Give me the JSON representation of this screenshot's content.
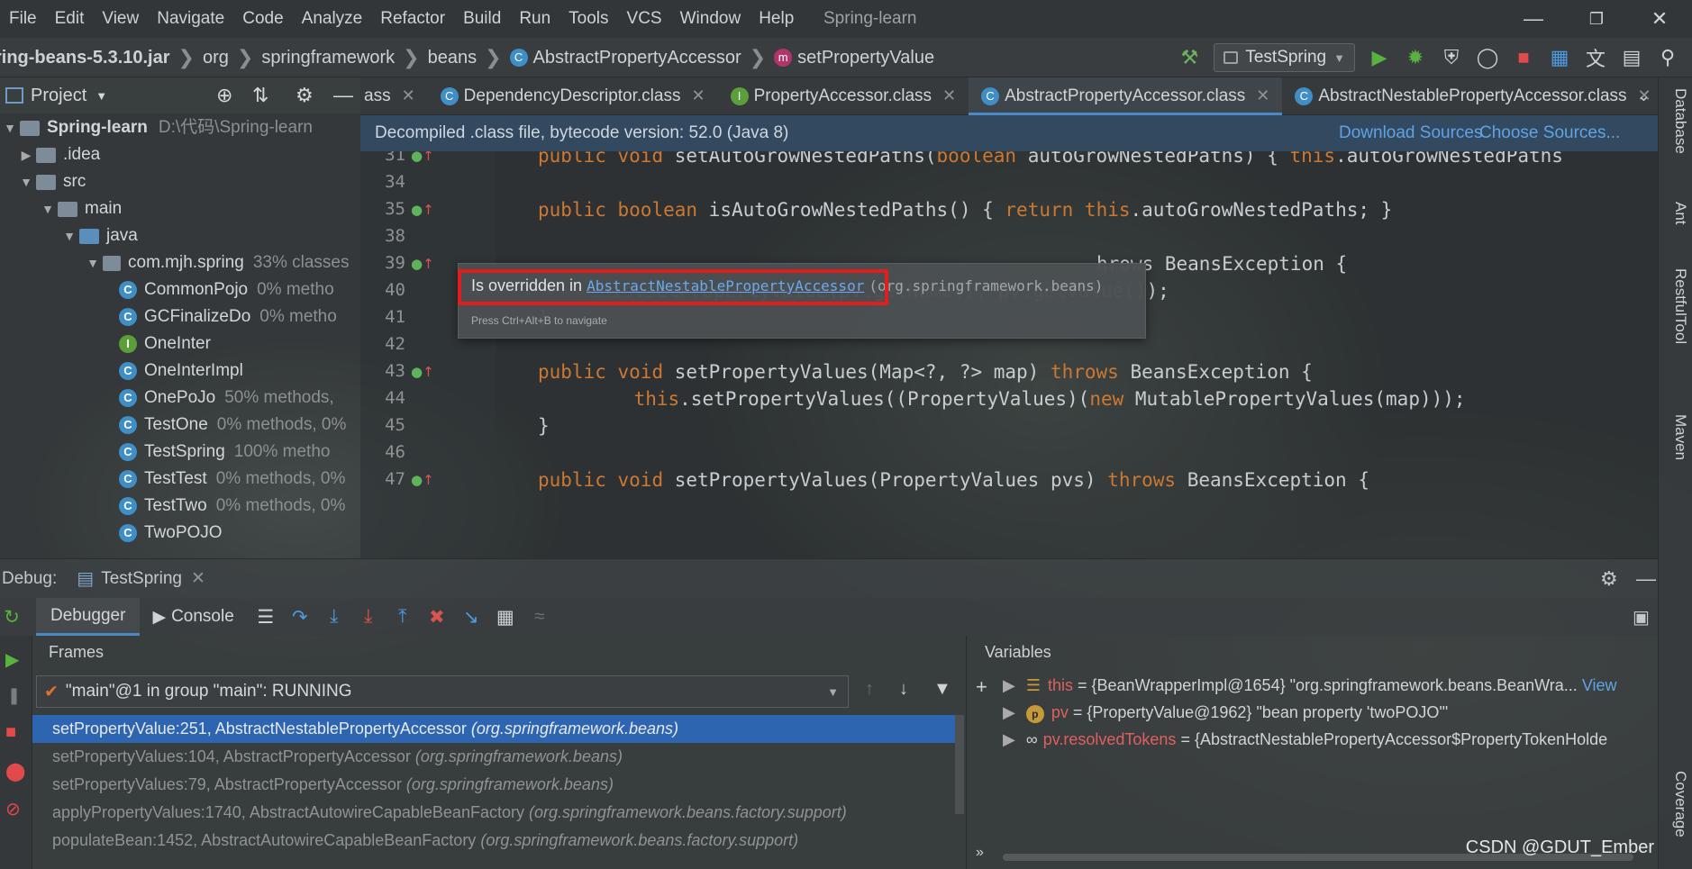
{
  "menu": [
    "File",
    "Edit",
    "View",
    "Navigate",
    "Code",
    "Analyze",
    "Refactor",
    "Build",
    "Run",
    "Tools",
    "VCS",
    "Window",
    "Help"
  ],
  "app_title": "Spring-learn",
  "breadcrumb": [
    "ring-beans-5.3.10.jar",
    "org",
    "springframework",
    "beans",
    "AbstractPropertyAccessor",
    "setPropertyValue"
  ],
  "run_config": "TestSpring",
  "project": {
    "title": "Project",
    "items": [
      {
        "label": "Spring-learn",
        "extra": "D:\\代码\\Spring-learn",
        "kind": "module"
      },
      {
        "label": ".idea",
        "extra": "",
        "kind": "folder"
      },
      {
        "label": "src",
        "extra": "",
        "kind": "folder"
      },
      {
        "label": "main",
        "extra": "",
        "kind": "folder"
      },
      {
        "label": "java",
        "extra": "",
        "kind": "srcfolder"
      },
      {
        "label": "com.mjh.spring",
        "extra": "33% classes",
        "kind": "package"
      },
      {
        "label": "CommonPojo",
        "extra": "0% metho",
        "kind": "class"
      },
      {
        "label": "GCFinalizeDo",
        "extra": "0% metho",
        "kind": "class"
      },
      {
        "label": "OneInter",
        "extra": "",
        "kind": "interface"
      },
      {
        "label": "OneInterImpl",
        "extra": "",
        "kind": "class"
      },
      {
        "label": "OnePoJo",
        "extra": "50% methods,",
        "kind": "class"
      },
      {
        "label": "TestOne",
        "extra": "0% methods, 0%",
        "kind": "class"
      },
      {
        "label": "TestSpring",
        "extra": "100% metho",
        "kind": "class"
      },
      {
        "label": "TestTest",
        "extra": "0% methods, 0%",
        "kind": "class"
      },
      {
        "label": "TestTwo",
        "extra": "0% methods, 0%",
        "kind": "class"
      },
      {
        "label": "TwoPOJO",
        "extra": "",
        "kind": "class"
      }
    ]
  },
  "tabs": [
    {
      "label": "ass",
      "icon": "",
      "active": false
    },
    {
      "label": "DependencyDescriptor.class",
      "icon": "C",
      "active": false
    },
    {
      "label": "PropertyAccessor.class",
      "icon": "I",
      "active": false
    },
    {
      "label": "AbstractPropertyAccessor.class",
      "icon": "C",
      "active": true
    },
    {
      "label": "AbstractNestablePropertyAccessor.class",
      "icon": "C",
      "active": false
    }
  ],
  "infobar": {
    "text": "Decompiled .class file, bytecode version: 52.0 (Java 8)",
    "download": "Download Sources",
    "choose": "Choose Sources..."
  },
  "code_lines": [
    {
      "n": "31",
      "text": "public void setAutoGrowNestedPaths(boolean autoGrowNestedPaths) { this.autoGrowNestedPaths"
    },
    {
      "n": "34",
      "text": ""
    },
    {
      "n": "35",
      "text": "public boolean isAutoGrowNestedPaths() { return this.autoGrowNestedPaths; }"
    },
    {
      "n": "38",
      "text": ""
    },
    {
      "n": "39",
      "text": "hrows BeansException {"
    },
    {
      "n": "40",
      "text": "this.setPropertyValue(pv.getName(), pv.getValue());"
    },
    {
      "n": "41",
      "text": "}"
    },
    {
      "n": "42",
      "text": ""
    },
    {
      "n": "43",
      "text": "public void setPropertyValues(Map<?, ?> map) throws BeansException {"
    },
    {
      "n": "44",
      "text": "    this.setPropertyValues((PropertyValues)(new MutablePropertyValues(map)));"
    },
    {
      "n": "45",
      "text": "}"
    },
    {
      "n": "46",
      "text": ""
    },
    {
      "n": "47",
      "text": "public void setPropertyValues(PropertyValues pvs) throws BeansException {"
    }
  ],
  "tooltip": {
    "prefix": "Is overridden in ",
    "link": "AbstractNestablePropertyAccessor",
    "pkg": "(org.springframework.beans)",
    "hint": "Press Ctrl+Alt+B to navigate"
  },
  "right_tools": [
    "Database",
    "Ant",
    "RestfulTool",
    "Maven",
    "Coverage"
  ],
  "debug": {
    "label": "Debug:",
    "session": "TestSpring",
    "tab_debugger": "Debugger",
    "tab_console": "Console",
    "frames_title": "Frames",
    "variables_title": "Variables",
    "thread": "\"main\"@1 in group \"main\": RUNNING",
    "frames": [
      {
        "method": "setPropertyValue:251, AbstractNestablePropertyAccessor",
        "pkg": "(org.springframework.beans)"
      },
      {
        "method": "setPropertyValues:104, AbstractPropertyAccessor",
        "pkg": "(org.springframework.beans)"
      },
      {
        "method": "setPropertyValues:79, AbstractPropertyAccessor",
        "pkg": "(org.springframework.beans)"
      },
      {
        "method": "applyPropertyValues:1740, AbstractAutowireCapableBeanFactory",
        "pkg": "(org.springframework.beans.factory.support)"
      },
      {
        "method": "populateBean:1452, AbstractAutowireCapableBeanFactory",
        "pkg": "(org.springframework.beans.factory.support)"
      }
    ],
    "variables": [
      {
        "name": "this",
        "value": " = {BeanWrapperImpl@1654} \"org.springframework.beans.BeanWra...",
        "extra": "View"
      },
      {
        "name": "pv",
        "value": " = {PropertyValue@1962} \"bean property 'twoPOJO'\"",
        "extra": ""
      },
      {
        "name": "pv.resolvedTokens",
        "value": " = {AbstractNestablePropertyAccessor$PropertyTokenHolde",
        "extra": ""
      }
    ]
  },
  "watermark": "CSDN @GDUT_Ember",
  "colors": {
    "keyword": "#cc7832",
    "link": "#5fa3e6",
    "selection": "#2e65b1",
    "highlight_box": "#e21d1d",
    "infobar": "#33495f"
  }
}
